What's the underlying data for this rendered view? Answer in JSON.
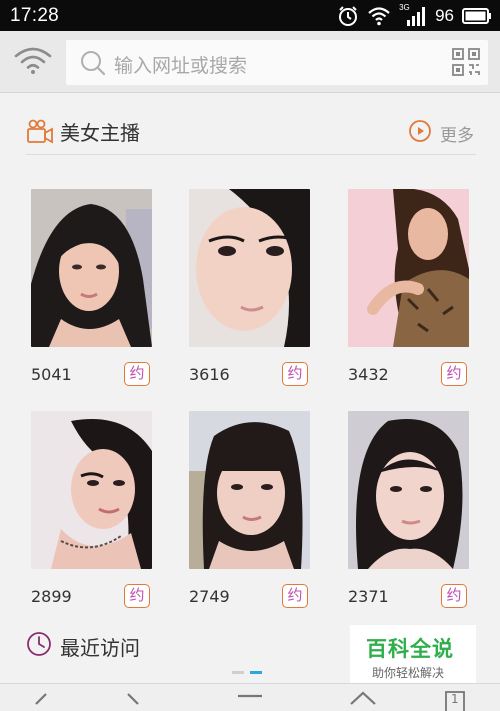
{
  "status_bar": {
    "time": "17:28",
    "network_label": "3G",
    "battery": "96"
  },
  "address_bar": {
    "placeholder": "输入网址或搜索"
  },
  "section_anchors": {
    "title": "美女主播",
    "more": "更多",
    "cards": [
      {
        "count": "5041",
        "badge": "约"
      },
      {
        "count": "3616",
        "badge": "约"
      },
      {
        "count": "3432",
        "badge": "约"
      },
      {
        "count": "2899",
        "badge": "约"
      },
      {
        "count": "2749",
        "badge": "约"
      },
      {
        "count": "2371",
        "badge": "约"
      }
    ]
  },
  "section_recent": {
    "title": "最近访问"
  },
  "watermark": {
    "title": "百科全说",
    "subtitle": "助你轻松解决"
  },
  "bottom_nav": {
    "tab_count": "1"
  },
  "colors": {
    "accent_orange": "#e07a3b",
    "badge_purple": "#c14fb1",
    "recent_purple": "#8a2c6e",
    "watermark_green": "#2fae4c",
    "page_indicator": "#2aa7e0"
  }
}
